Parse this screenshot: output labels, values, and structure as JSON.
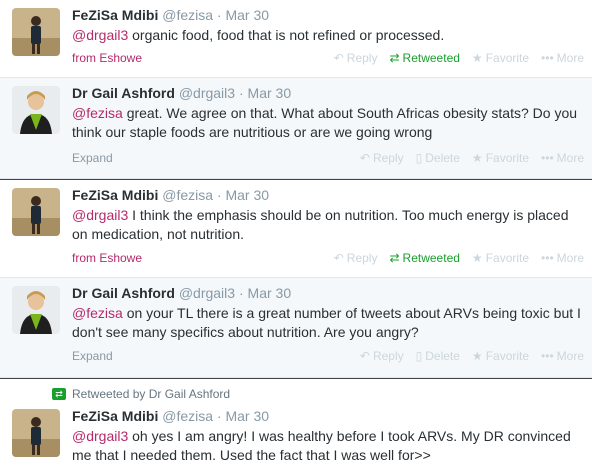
{
  "colors": {
    "mention": "#b52a6b",
    "retweeted": "#19a02c",
    "muted": "#8899a6",
    "action_idle": "#ccd6dd"
  },
  "tweets": [
    {
      "fullname": "FeZiSa Mdibi",
      "handle": "@fezisa",
      "dot": "·",
      "time": "Mar 30",
      "mention": "@drgail3",
      "text": "organic food, food that is not refined or processed.",
      "source": "from Eshowe",
      "actions": {
        "reply": "Reply",
        "retweet": "Retweeted",
        "favorite": "Favorite",
        "more": "More"
      }
    },
    {
      "fullname": "Dr Gail Ashford",
      "handle": "@drgail3",
      "dot": "·",
      "time": "Mar 30",
      "mention": "@fezisa",
      "text": "great. We agree on that. What about South Africas obesity stats? Do you think our staple foods are nutritious or are we going wrong",
      "expand": "Expand",
      "actions": {
        "reply": "Reply",
        "delete": "Delete",
        "favorite": "Favorite",
        "more": "More"
      }
    },
    {
      "fullname": "FeZiSa Mdibi",
      "handle": "@fezisa",
      "dot": "·",
      "time": "Mar 30",
      "mention": "@drgail3",
      "text": "I think the emphasis should be on nutrition. Too much energy is placed on medication,  not nutrition.",
      "source": "from Eshowe",
      "actions": {
        "reply": "Reply",
        "retweet": "Retweeted",
        "favorite": "Favorite",
        "more": "More"
      }
    },
    {
      "fullname": "Dr Gail Ashford",
      "handle": "@drgail3",
      "dot": "·",
      "time": "Mar 30",
      "mention": "@fezisa",
      "text": "on your TL there is a great number of tweets about ARVs being toxic but I don't see many specifics about nutrition. Are you angry?",
      "expand": "Expand",
      "actions": {
        "reply": "Reply",
        "delete": "Delete",
        "favorite": "Favorite",
        "more": "More"
      }
    },
    {
      "retweet_context": "Retweeted by Dr Gail Ashford",
      "fullname": "FeZiSa Mdibi",
      "handle": "@fezisa",
      "dot": "·",
      "time": "Mar 30",
      "mention": "@drgail3",
      "text": "oh yes I am angry! I was healthy before I took ARVs. My DR convinced me that I needed them. Used the fact that I was well for>>"
    }
  ]
}
